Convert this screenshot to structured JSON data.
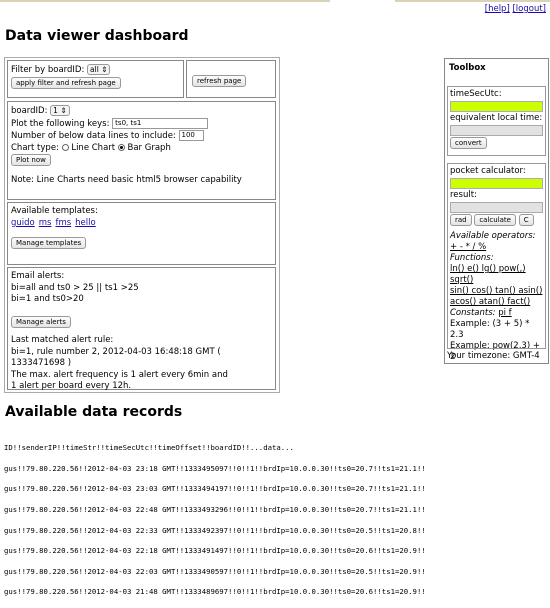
{
  "header": {
    "help": "[help]",
    "logout": "[logout]",
    "title": "Data viewer dashboard"
  },
  "filter": {
    "label": "Filter by boardID:",
    "value": "all",
    "apply_btn": "apply filter and refresh page",
    "refresh_btn": "refresh page"
  },
  "plot": {
    "board_label": "boardID:",
    "board_value": "1",
    "keys_label": "Plot the following keys:",
    "keys_value": "ts0, ts1",
    "lines_label": "Number of below data lines to include:",
    "lines_value": "100",
    "chart_type_label": "Chart type:",
    "line_chart": "Line Chart",
    "bar_graph": "Bar Graph",
    "plot_btn": "Plot now",
    "note": "Note: Line Charts need basic html5 browser capability"
  },
  "templates": {
    "label": "Available templates:",
    "items": [
      "guido",
      "ms",
      "fms",
      "hello"
    ],
    "manage_btn": "Manage templates"
  },
  "alerts": {
    "label": "Email alerts:",
    "rule1": "bi=all and ts0 > 25 || ts1 >25",
    "rule2": "bi=1 and ts0>20",
    "manage_btn": "Manage alerts",
    "last_label": "Last matched alert rule:",
    "last_value": "bi=1, rule number 2, 2012-04-03 16:48:18 GMT ( 1333471698 )",
    "freq1": "The max. alert frequency is 1 alert every 6min and",
    "freq2": "1 alert per board every 12h."
  },
  "toolbox": {
    "title": "Toolbox",
    "time_label": "timeSecUtc:",
    "local_label": "equivalent local time:",
    "convert_btn": "convert",
    "calc_label": "pocket calculator:",
    "result_label": "result:",
    "rad_btn": "rad",
    "calc_btn": "calculate",
    "c_btn": "C",
    "ops_label": "Available operators:",
    "ops_value": "+ - * / %",
    "funcs_label": "Functions:",
    "funcs1": "ln() e() lg() pow(,) sqrt()",
    "funcs2": "sin() cos() tan() asin()",
    "funcs3": "acos() atan() fact()",
    "consts_label": "Constants:",
    "consts_value": "pi f",
    "ex1": "Example: (3 + 5) * 2.3",
    "ex2": "Example: pow(2,3) + 2",
    "timezone": "Your timezone: GMT-4"
  },
  "records": {
    "title": "Available data records",
    "header": "ID!!senderIP!!timeStr!!timeSecUtc!!timeOffset!!boardID!!...data...",
    "rows": [
      "gus!!79.80.220.56!!2012-04-03 23:18 GMT!!1333495097!!0!!1!!brdIp=10.0.0.30!!ts0=20.7!!ts1=21.1!!",
      "gus!!79.80.220.56!!2012-04-03 23:03 GMT!!1333494197!!0!!1!!brdIp=10.0.0.30!!ts0=20.7!!ts1=21.1!!",
      "gus!!79.80.220.56!!2012-04-03 22:48 GMT!!1333493296!!0!!1!!brdIp=10.0.0.30!!ts0=20.7!!ts1=21.1!!",
      "gus!!79.80.220.56!!2012-04-03 22:33 GMT!!1333492397!!0!!1!!brdIp=10.0.0.30!!ts0=20.5!!ts1=20.8!!",
      "gus!!79.80.220.56!!2012-04-03 22:18 GMT!!1333491497!!0!!1!!brdIp=10.0.0.30!!ts0=20.6!!ts1=20.9!!",
      "gus!!79.80.220.56!!2012-04-03 22:03 GMT!!1333490597!!0!!1!!brdIp=10.0.0.30!!ts0=20.5!!ts1=20.9!!",
      "gus!!79.80.220.56!!2012-04-03 21:48 GMT!!1333489697!!0!!1!!brdIp=10.0.0.30!!ts0=20.6!!ts1=20.9!!"
    ]
  }
}
